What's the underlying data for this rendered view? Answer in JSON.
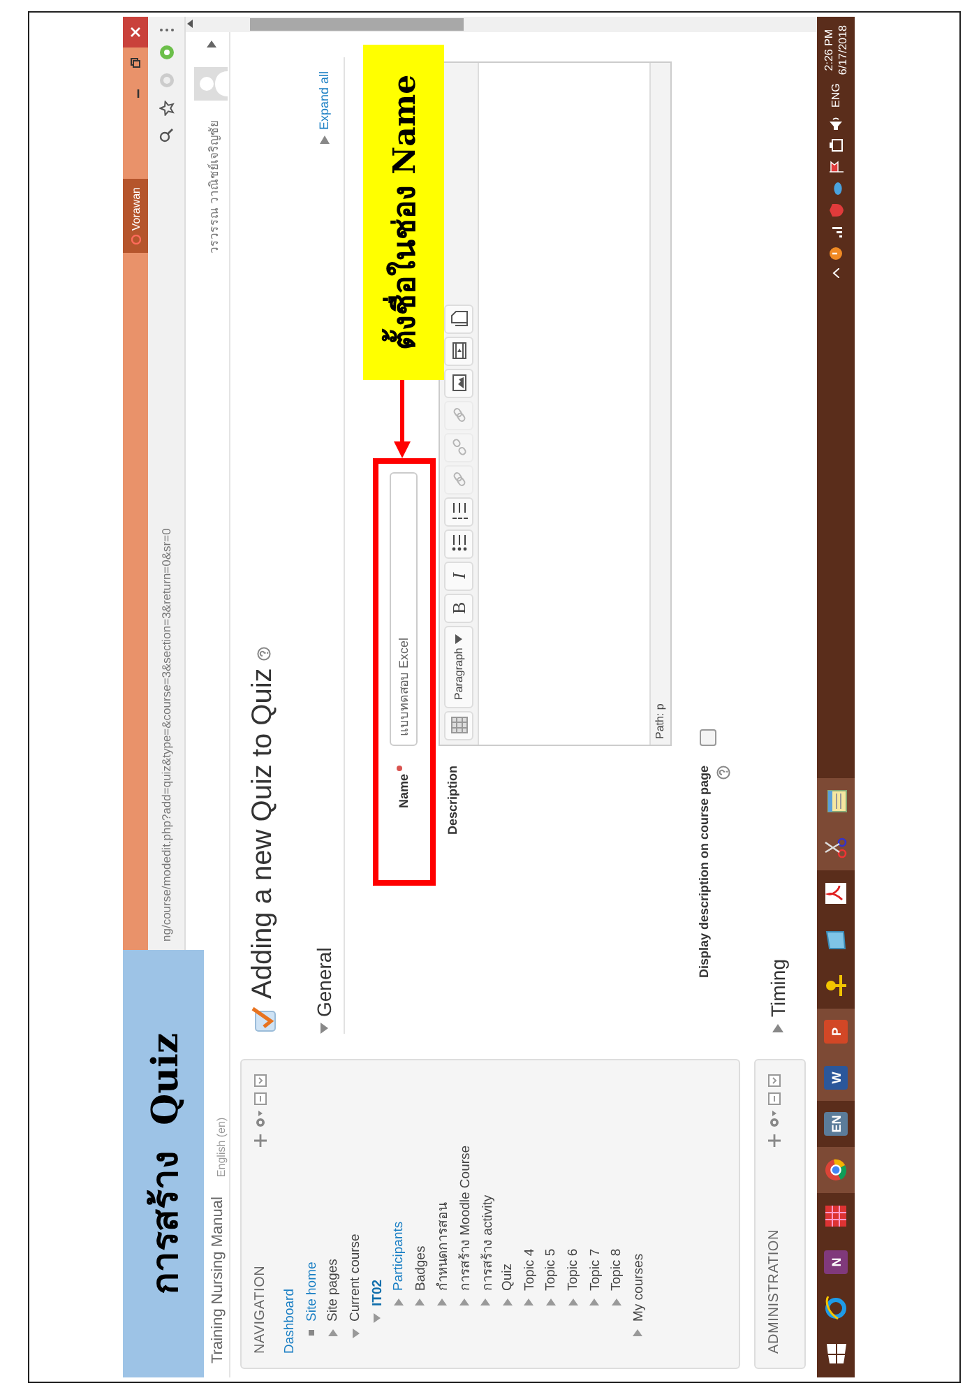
{
  "annotations": {
    "banner": "การสร้าง  Quiz",
    "callout": "ตั้งชื่อในช่อง Name"
  },
  "window": {
    "user_tag": "Vorawan"
  },
  "address_bar": {
    "url": "ng/course/modedit.php?add=quiz&type=&course=3&section=3&return=0&sr=0"
  },
  "site_header": {
    "site_name": "Training Nursing Manual",
    "language": "English (en)",
    "user_name": "วรวรรณ วาณิชย์เจริญชัย"
  },
  "navigation": {
    "title": "NAVIGATION",
    "items": [
      {
        "label": "Dashboard",
        "link": true,
        "active": false,
        "children": [
          {
            "label": "Site home",
            "kind": "leaf",
            "link": true,
            "active": false
          },
          {
            "label": "Site pages",
            "kind": "branch",
            "link": false,
            "active": false,
            "expanded": false
          },
          {
            "label": "Current course",
            "kind": "branch",
            "link": false,
            "active": false,
            "expanded": true,
            "children": [
              {
                "label": "IT02",
                "kind": "branch",
                "link": true,
                "active": true,
                "expanded": true,
                "children": [
                  {
                    "label": "Participants",
                    "kind": "branch",
                    "link": true,
                    "active": false,
                    "expanded": false
                  },
                  {
                    "label": "Badges",
                    "kind": "branch",
                    "link": false,
                    "active": false,
                    "expanded": false
                  },
                  {
                    "label": "กำหนดการสอน",
                    "kind": "branch",
                    "link": false,
                    "active": false,
                    "expanded": false
                  },
                  {
                    "label": "การสร้าง Moodle Course",
                    "kind": "branch",
                    "link": false,
                    "active": false,
                    "expanded": false
                  },
                  {
                    "label": "การสร้าง activity",
                    "kind": "branch",
                    "link": false,
                    "active": false,
                    "expanded": false
                  },
                  {
                    "label": "Quiz",
                    "kind": "branch",
                    "link": false,
                    "active": false,
                    "expanded": false
                  },
                  {
                    "label": "Topic 4",
                    "kind": "branch",
                    "link": false,
                    "active": false,
                    "expanded": false
                  },
                  {
                    "label": "Topic 5",
                    "kind": "branch",
                    "link": false,
                    "active": false,
                    "expanded": false
                  },
                  {
                    "label": "Topic 6",
                    "kind": "branch",
                    "link": false,
                    "active": false,
                    "expanded": false
                  },
                  {
                    "label": "Topic 7",
                    "kind": "branch",
                    "link": false,
                    "active": false,
                    "expanded": false
                  },
                  {
                    "label": "Topic 8",
                    "kind": "branch",
                    "link": false,
                    "active": false,
                    "expanded": false
                  }
                ]
              }
            ]
          },
          {
            "label": "My courses",
            "kind": "branch",
            "link": false,
            "active": false,
            "expanded": false
          }
        ]
      }
    ]
  },
  "administration": {
    "title": "ADMINISTRATION"
  },
  "form": {
    "heading": "Adding a new Quiz to Quiz",
    "expand_all": "Expand all",
    "sections": [
      {
        "legend": "General",
        "expanded": true
      },
      {
        "legend": "Timing",
        "expanded": false
      }
    ],
    "name_field": {
      "label": "Name",
      "required": true,
      "value": "แบบทดสอบ Excel"
    },
    "description": {
      "label": "Description",
      "path": "Path: p",
      "toolbar": [
        {
          "kind": "toggle",
          "disabled": false
        },
        {
          "kind": "dropdown",
          "label": "Paragraph",
          "disabled": false
        },
        {
          "kind": "bold",
          "label": "B",
          "disabled": false
        },
        {
          "kind": "italic",
          "label": "I",
          "disabled": false
        },
        {
          "kind": "bullets",
          "disabled": false
        },
        {
          "kind": "numbers",
          "disabled": false
        },
        {
          "kind": "link",
          "disabled": true
        },
        {
          "kind": "unlink",
          "disabled": true
        },
        {
          "kind": "link",
          "disabled": true
        },
        {
          "kind": "image",
          "disabled": false
        },
        {
          "kind": "media",
          "disabled": false
        },
        {
          "kind": "files",
          "disabled": false
        }
      ]
    },
    "show_description": {
      "label": "Display description on course page",
      "checked": false
    }
  },
  "taskbar": {
    "apps": [
      {
        "kind": "ie",
        "highlighted": false
      },
      {
        "kind": "notebook",
        "glyph": "N",
        "highlighted": false
      },
      {
        "kind": "grid",
        "highlighted": false
      },
      {
        "kind": "chrome",
        "highlighted": true
      },
      {
        "kind": "keyboard",
        "glyph": "EN",
        "highlighted": false
      },
      {
        "kind": "word",
        "glyph": "W",
        "highlighted": true
      },
      {
        "kind": "slides",
        "glyph": "P",
        "highlighted": true
      },
      {
        "kind": "key",
        "highlighted": false
      },
      {
        "kind": "glass",
        "highlighted": false
      },
      {
        "kind": "pdf",
        "highlighted": false
      },
      {
        "kind": "scissors",
        "highlighted": true
      },
      {
        "kind": "notepad",
        "highlighted": true
      }
    ],
    "tray": {
      "language": "ENG",
      "time": "2:26 PM",
      "date": "6/17/2018"
    }
  }
}
